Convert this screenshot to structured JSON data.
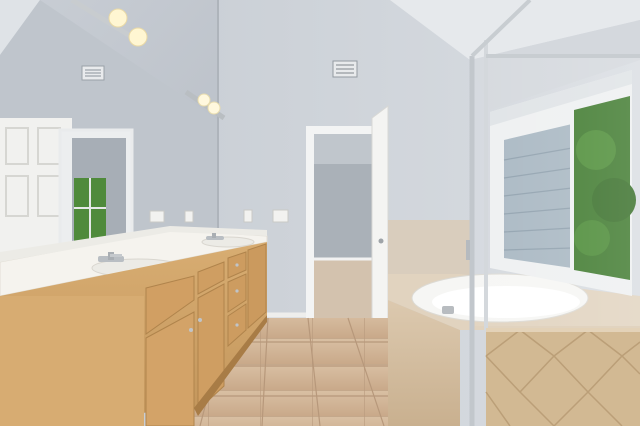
{
  "scene": {
    "colors": {
      "wall": "#cfd4da",
      "wall_shade": "#bcc2c9",
      "ceiling": "#e8ecef",
      "cabinet": "#d3a76b",
      "cabinet_dark": "#b88a50",
      "countertop": "#f3f0e8",
      "floor_tile": "#d4b79a",
      "floor_grout": "#bfa184",
      "tub_tile": "#d6c2a8",
      "glass_frame": "#c9cdd1",
      "foliage": "#3f7a2e",
      "siding": "#a9b9c4"
    },
    "icons": [
      "vanity-light-icon",
      "air-vent-icon",
      "faucet-icon",
      "light-switch-icon"
    ]
  }
}
